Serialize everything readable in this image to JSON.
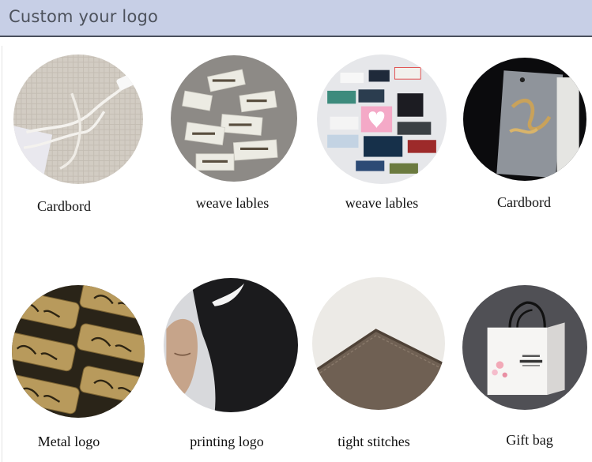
{
  "header": {
    "title": "Custom your logo"
  },
  "products": [
    {
      "label": "Cardbord",
      "image": "hang-tag-string-image"
    },
    {
      "label": "weave lables",
      "image": "woven-labels-image"
    },
    {
      "label": "weave lables",
      "image": "colorful-labels-image"
    },
    {
      "label": "Cardbord",
      "image": "clear-hang-tag-image"
    },
    {
      "label": "Metal logo",
      "image": "metal-logo-image"
    },
    {
      "label": "printing logo",
      "image": "printed-hijab-logo-image"
    },
    {
      "label": "tight stitches",
      "image": "stitched-fabric-image"
    },
    {
      "label": "Gift bag",
      "image": "gift-bag-image"
    }
  ]
}
